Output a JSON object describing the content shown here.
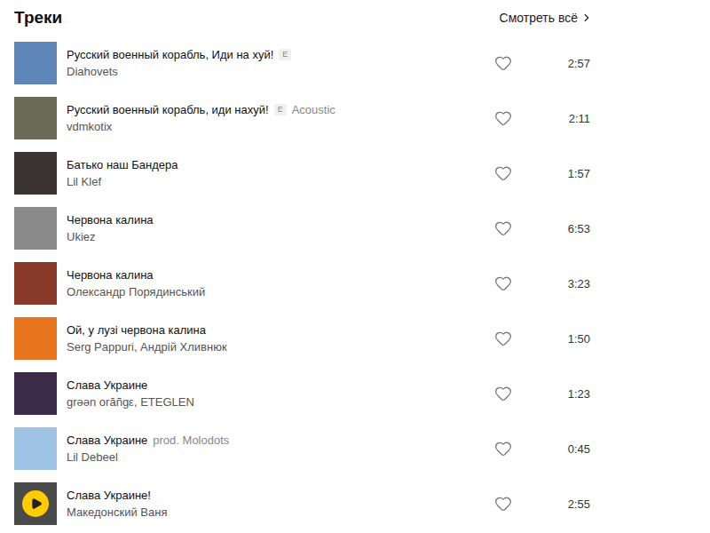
{
  "section": {
    "title": "Треки",
    "see_all": "Смотреть всё"
  },
  "tracks": [
    {
      "title": "Русский военный корабль, Иди на хуй!",
      "badge": "E",
      "version": "",
      "artist": "Diahovets",
      "duration": "2:57",
      "liked": false,
      "play_button": false,
      "color": "#5f86b8"
    },
    {
      "title": "Русский военный корабль, иди нахуй!",
      "badge": "E",
      "version": "Acoustic",
      "artist": "vdmkotix",
      "duration": "2:11",
      "liked": false,
      "play_button": false,
      "color": "#6b6a55"
    },
    {
      "title": "Батько наш Бандера",
      "badge": "",
      "version": "",
      "artist": "Lil Klef",
      "duration": "1:57",
      "liked": false,
      "play_button": false,
      "color": "#3a3434"
    },
    {
      "title": "Червона калина",
      "badge": "",
      "version": "",
      "artist": "Ukiez",
      "duration": "6:53",
      "liked": false,
      "play_button": false,
      "color": "#8a8a8a"
    },
    {
      "title": "Червона калина",
      "badge": "",
      "version": "",
      "artist": "Олександр Порядинський",
      "duration": "3:23",
      "liked": false,
      "play_button": false,
      "color": "#8a3a2a"
    },
    {
      "title": "Ой, у лузі червона калина",
      "badge": "",
      "version": "",
      "artist": "Serg Pappuri, Андрій Хливнюк",
      "duration": "1:50",
      "liked": false,
      "play_button": false,
      "color": "#e8741e"
    },
    {
      "title": "Слава Украине",
      "badge": "",
      "version": "",
      "artist": "grəən orăñgε, ETEGLEN",
      "duration": "1:23",
      "liked": false,
      "play_button": false,
      "color": "#3b2a4a"
    },
    {
      "title": "Слава Украине",
      "badge": "",
      "version": "prod. Molodots",
      "artist": "Lil Debeel",
      "duration": "0:45",
      "liked": false,
      "play_button": false,
      "color": "#9fc3e4"
    },
    {
      "title": "Слава Украине!",
      "badge": "",
      "version": "",
      "artist": "Македонский Ваня",
      "duration": "2:55",
      "liked": false,
      "play_button": true,
      "color": "#4a4a4a"
    }
  ]
}
